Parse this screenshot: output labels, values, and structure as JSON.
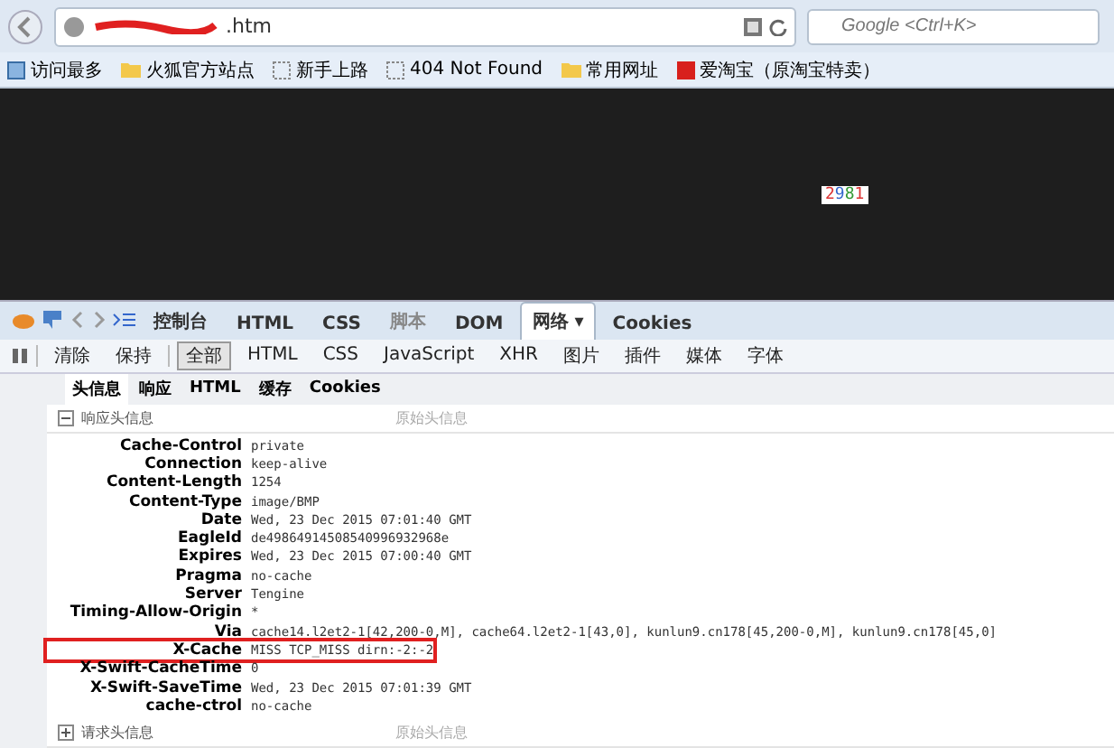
{
  "address_bar": {
    "url": ".htm"
  },
  "search": {
    "placeholder": "Google <Ctrl+K>"
  },
  "bookmarks": [
    {
      "label": "访问最多",
      "kind": "smart"
    },
    {
      "label": "火狐官方站点",
      "kind": "folder"
    },
    {
      "label": "新手上路",
      "kind": "page"
    },
    {
      "label": "404 Not Found",
      "kind": "page"
    },
    {
      "label": "常用网址",
      "kind": "folder"
    },
    {
      "label": "爱淘宝（原淘宝特卖）",
      "kind": "taobao"
    }
  ],
  "page": {
    "captcha": [
      "2",
      "9",
      "8",
      "1"
    ]
  },
  "devtools": {
    "panels": [
      {
        "label": "控制台",
        "selected": false,
        "disabled": false
      },
      {
        "label": "HTML",
        "selected": false,
        "disabled": false
      },
      {
        "label": "CSS",
        "selected": false,
        "disabled": false
      },
      {
        "label": "脚本",
        "selected": false,
        "disabled": true
      },
      {
        "label": "DOM",
        "selected": false,
        "disabled": false
      },
      {
        "label": "网络 ▾",
        "selected": true,
        "disabled": false
      },
      {
        "label": "Cookies",
        "selected": false,
        "disabled": false
      }
    ],
    "actions": [
      "清除",
      "保持"
    ],
    "filters": [
      {
        "label": "全部",
        "selected": true
      },
      {
        "label": "HTML",
        "selected": false
      },
      {
        "label": "CSS",
        "selected": false
      },
      {
        "label": "JavaScript",
        "selected": false
      },
      {
        "label": "XHR",
        "selected": false
      },
      {
        "label": "图片",
        "selected": false
      },
      {
        "label": "插件",
        "selected": false
      },
      {
        "label": "媒体",
        "selected": false
      },
      {
        "label": "字体",
        "selected": false
      }
    ],
    "subtabs": [
      {
        "label": "头信息",
        "selected": true
      },
      {
        "label": "响应",
        "selected": false
      },
      {
        "label": "HTML",
        "selected": false
      },
      {
        "label": "缓存",
        "selected": false
      },
      {
        "label": "Cookies",
        "selected": false
      }
    ],
    "response_section": {
      "title": "响应头信息",
      "expanded": true,
      "raw_link": "原始头信息"
    },
    "headers": [
      {
        "name": "Cache-Control",
        "value": "private",
        "highlighted": false
      },
      {
        "name": "Connection",
        "value": "keep-alive",
        "highlighted": false
      },
      {
        "name": "Content-Length",
        "value": "1254",
        "highlighted": false
      },
      {
        "name": "Content-Type",
        "value": "image/BMP",
        "highlighted": false
      },
      {
        "name": "Date",
        "value": "Wed, 23 Dec 2015 07:01:40 GMT",
        "highlighted": false
      },
      {
        "name": "EagleId",
        "value": "de49864914508540996932968e",
        "highlighted": false
      },
      {
        "name": "Expires",
        "value": "Wed, 23 Dec 2015 07:00:40 GMT",
        "highlighted": false
      },
      {
        "name": "Pragma",
        "value": "no-cache",
        "highlighted": false
      },
      {
        "name": "Server",
        "value": "Tengine",
        "highlighted": false
      },
      {
        "name": "Timing-Allow-Origin",
        "value": "*",
        "highlighted": false
      },
      {
        "name": "Via",
        "value": "cache14.l2et2-1[42,200-0,M], cache64.l2et2-1[43,0], kunlun9.cn178[45,200-0,M], kunlun9.cn178[45,0]",
        "highlighted": false
      },
      {
        "name": "X-Cache",
        "value": "MISS TCP_MISS dirn:-2:-2",
        "highlighted": true
      },
      {
        "name": "X-Swift-CacheTime",
        "value": "0",
        "highlighted": false
      },
      {
        "name": "X-Swift-SaveTime",
        "value": "Wed, 23 Dec 2015 07:01:39 GMT",
        "highlighted": false
      },
      {
        "name": "cache-ctrol",
        "value": "no-cache",
        "highlighted": false
      }
    ],
    "request_section": {
      "title": "请求头信息",
      "expanded": false,
      "raw_link": "原始头信息"
    }
  }
}
